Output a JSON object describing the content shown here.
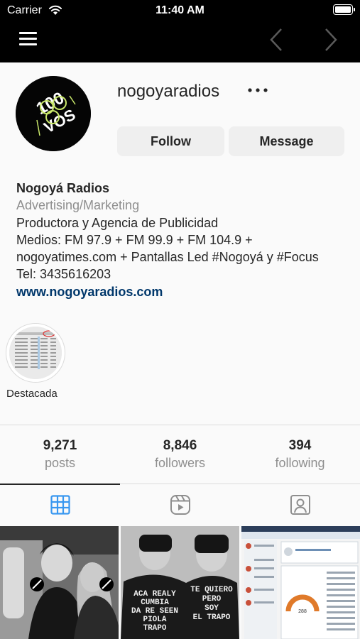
{
  "status_bar": {
    "carrier": "Carrier",
    "time": "11:40 AM"
  },
  "profile": {
    "username": "nogoyaradios",
    "avatar_text": [
      "100",
      "VOS"
    ],
    "follow_label": "Follow",
    "message_label": "Message"
  },
  "bio": {
    "name": "Nogoyá Radios",
    "category": "Advertising/Marketing",
    "lines": [
      "Productora y Agencia de Publicidad",
      "Medios: FM 97.9 + FM 99.9 + FM 104.9 +",
      "nogoyatimes.com + Pantallas Led #Nogoyá y #Focus",
      "Tel: 3435616203"
    ],
    "website": "www.nogoyaradios.com"
  },
  "highlights": [
    {
      "label": "Destacada"
    }
  ],
  "stats": {
    "posts": {
      "value": "9,271",
      "label": "posts"
    },
    "followers": {
      "value": "8,846",
      "label": "followers"
    },
    "following": {
      "value": "394",
      "label": "following"
    }
  },
  "tabs": [
    {
      "icon": "grid-icon",
      "active": true
    },
    {
      "icon": "reels-icon",
      "active": false
    },
    {
      "icon": "tagged-icon",
      "active": false
    }
  ],
  "posts": [
    {
      "description": "photo"
    },
    {
      "shirt_text_left": [
        "ACA REALY",
        "CUMBIA",
        "DA RE SEEN",
        "PIOLA",
        "TRAPO"
      ],
      "shirt_text_right": [
        "TE QUIERO",
        "PERO",
        "SOY",
        "EL TRAPO"
      ]
    },
    {
      "description": "screenshot"
    }
  ],
  "colors": {
    "link": "#00376b",
    "secondary_text": "#8e8e8e",
    "button_bg": "#efefef",
    "active_tab": "#3897f0"
  }
}
